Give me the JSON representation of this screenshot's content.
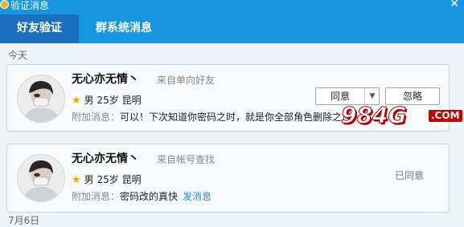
{
  "window": {
    "title": "验证消息",
    "close_glyph": "✕"
  },
  "tabs": [
    {
      "label": "好友验证",
      "active": true
    },
    {
      "label": "群系统消息",
      "active": false
    }
  ],
  "sections": [
    {
      "date_label": "今天",
      "request": {
        "name": "无心亦无情丶",
        "source": "来自单向好友",
        "gender": "男",
        "age": "25岁",
        "location": "昆明",
        "message_label": "附加消息：",
        "message": "可以！下次知道你密码之时，就是你全部角色删除之日",
        "actions": {
          "agree_label": "同意",
          "ignore_label": "忽略"
        }
      }
    },
    {
      "request": {
        "name": "无心亦无情丶",
        "source": "来自帐号查找",
        "gender": "男",
        "age": "25岁",
        "location": "昆明",
        "message_label": "附加消息：",
        "message": "密码改的真快",
        "message_link": "发消息",
        "status": "已同意"
      }
    },
    {
      "date_label": "7月6日"
    }
  ],
  "watermark": {
    "text": "984G",
    "suffix": ".COM"
  },
  "colors": {
    "header": "#1596de",
    "active_tab": "#1c6fbc",
    "link": "#1e8fd6",
    "watermark": "#c40000"
  },
  "icons": {
    "app": "qq-icon",
    "star": "star-icon",
    "dropdown": "chevron-down-icon"
  }
}
